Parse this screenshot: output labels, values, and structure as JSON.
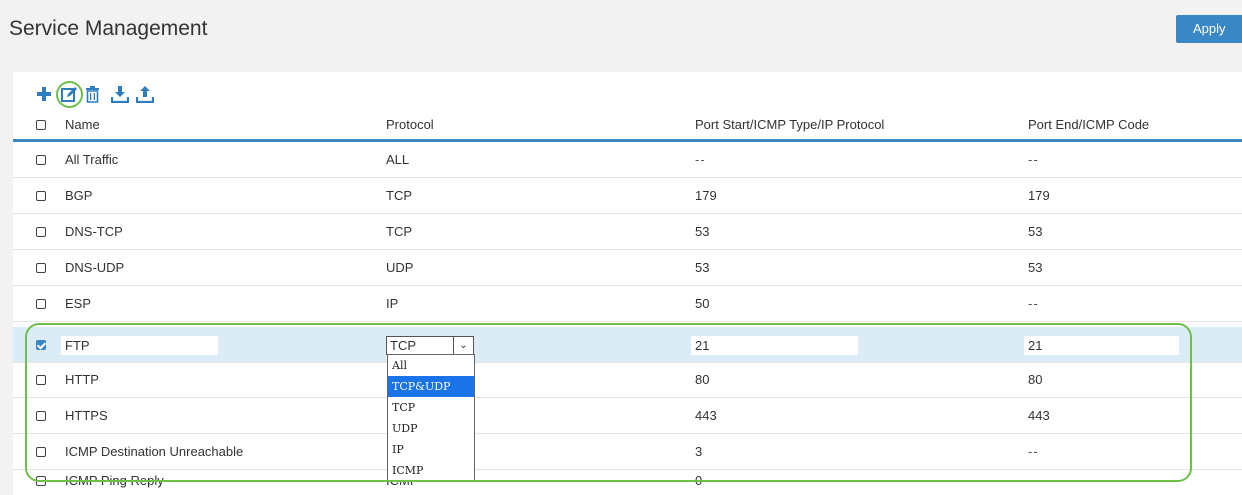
{
  "header": {
    "title": "Service Management",
    "apply_label": "Apply"
  },
  "toolbar": {
    "icons": [
      "add-icon",
      "edit-icon",
      "delete-icon",
      "import-icon",
      "export-icon"
    ]
  },
  "colors": {
    "accent": "#3a87c6",
    "highlight": "#6ebf4b",
    "selected_row": "#dbecf7",
    "dropdown_active": "#1a73e8"
  },
  "table": {
    "columns": [
      "Name",
      "Protocol",
      "Port Start/ICMP Type/IP Protocol",
      "Port End/ICMP Code"
    ],
    "rows": [
      {
        "name": "All Traffic",
        "protocol": "ALL",
        "start": "--",
        "end": "--"
      },
      {
        "name": "BGP",
        "protocol": "TCP",
        "start": "179",
        "end": "179"
      },
      {
        "name": "DNS-TCP",
        "protocol": "TCP",
        "start": "53",
        "end": "53"
      },
      {
        "name": "DNS-UDP",
        "protocol": "UDP",
        "start": "53",
        "end": "53"
      },
      {
        "name": "ESP",
        "protocol": "IP",
        "start": "50",
        "end": "--"
      },
      {
        "name": "FTP",
        "protocol": "TCP",
        "start": "21",
        "end": "21"
      },
      {
        "name": "HTTP",
        "protocol": "",
        "start": "80",
        "end": "80"
      },
      {
        "name": "HTTPS",
        "protocol": "",
        "start": "443",
        "end": "443"
      },
      {
        "name": "ICMP Destination Unreachable",
        "protocol": "",
        "start": "3",
        "end": "--"
      },
      {
        "name": "ICMP Ping Reply",
        "protocol": "ICMP",
        "start": "0",
        "end": "--"
      }
    ]
  },
  "protocol_select": {
    "selected": "TCP",
    "options": [
      "All",
      "TCP&UDP",
      "TCP",
      "UDP",
      "IP",
      "ICMP"
    ],
    "highlighted": "TCP&UDP"
  }
}
